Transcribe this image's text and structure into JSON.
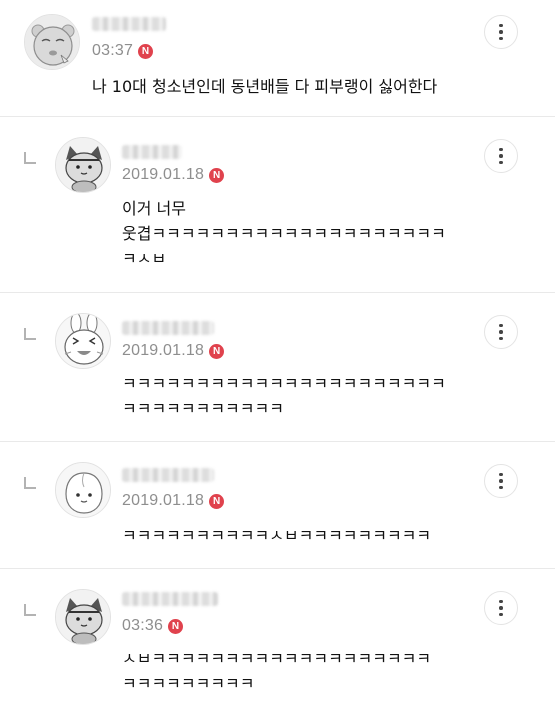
{
  "comments": [
    {
      "time": "03:37",
      "badge": "N",
      "text": "나 10대 청소년인데 동년배들 다 피부랭이 싫어한다",
      "avatar_icon": "round-face-avatar-icon"
    },
    {
      "time": "2019.01.18",
      "badge": "N",
      "text": "이거 너무\n웃겹ㅋㅋㅋㅋㅋㅋㅋㅋㅋㅋㅋㅋㅋㅋㅋㅋㅋㅋㅋㅋ\nㅋㅅㅂ",
      "avatar_icon": "cat-avatar-icon"
    },
    {
      "time": "2019.01.18",
      "badge": "N",
      "text": "ㅋㅋㅋㅋㅋㅋㅋㅋㅋㅋㅋㅋㅋㅋㅋㅋㅋㅋㅋㅋㅋㅋ\nㅋㅋㅋㅋㅋㅋㅋㅋㅋㅋㅋ",
      "avatar_icon": "bunny-avatar-icon"
    },
    {
      "time": "2019.01.18",
      "badge": "N",
      "text": "ㅋㅋㅋㅋㅋㅋㅋㅋㅋㅋㅅㅂㅋㅋㅋㅋㅋㅋㅋㅋㅋ",
      "avatar_icon": "peach-avatar-icon"
    },
    {
      "time": "03:36",
      "badge": "N",
      "text": "ㅅㅂㅋㅋㅋㅋㅋㅋㅋㅋㅋㅋㅋㅋㅋㅋㅋㅋㅋㅋㅋ\nㅋㅋㅋㅋㅋㅋㅋㅋㅋ",
      "avatar_icon": "cat-avatar-icon"
    }
  ]
}
